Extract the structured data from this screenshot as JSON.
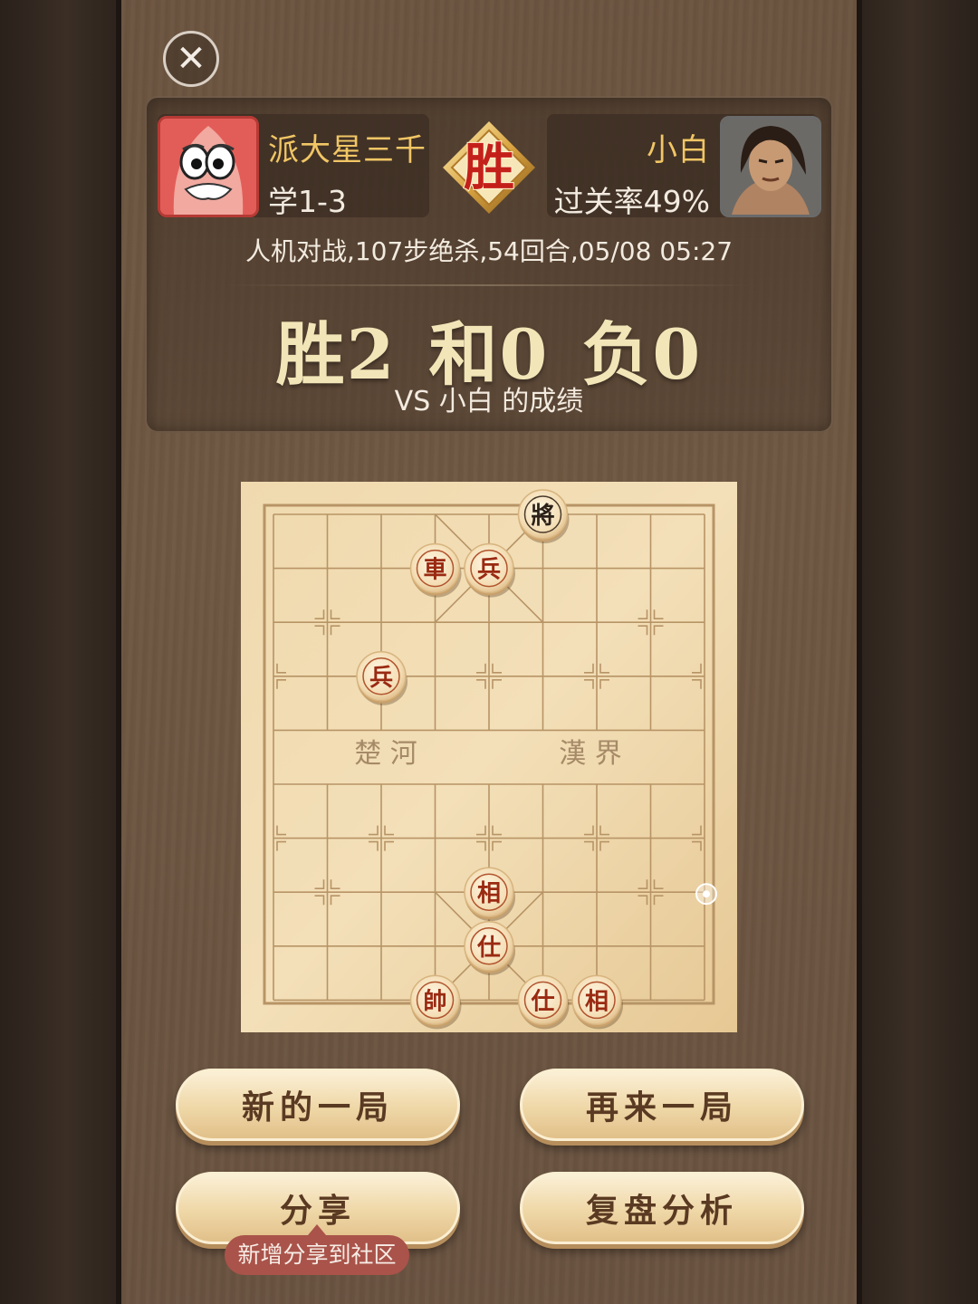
{
  "players": {
    "left": {
      "name": "派大星三千",
      "sub": "学1-3",
      "avatar": "patrick-star-avatar"
    },
    "right": {
      "name": "小白",
      "sub": "过关率49%",
      "avatar": "warrior-avatar"
    }
  },
  "result_badge": "胜",
  "game_info": "人机对战,107步绝杀,54回合,05/08 05:27",
  "score": {
    "win": "胜2",
    "draw": "和0",
    "loss": "负0"
  },
  "score_subtitle": "VS 小白 的成绩",
  "board": {
    "river_left": "楚 河",
    "river_right": "漢 界",
    "pieces": [
      {
        "label": "將",
        "col": 5,
        "row": 0,
        "side": "black"
      },
      {
        "label": "車",
        "col": 3,
        "row": 1,
        "side": "red"
      },
      {
        "label": "兵",
        "col": 4,
        "row": 1,
        "side": "red"
      },
      {
        "label": "兵",
        "col": 2,
        "row": 3,
        "side": "red"
      },
      {
        "label": "相",
        "col": 4,
        "row": 7,
        "side": "red"
      },
      {
        "label": "仕",
        "col": 4,
        "row": 8,
        "side": "red"
      },
      {
        "label": "帥",
        "col": 3,
        "row": 9,
        "side": "red"
      },
      {
        "label": "仕",
        "col": 5,
        "row": 9,
        "side": "red"
      },
      {
        "label": "相",
        "col": 6,
        "row": 9,
        "side": "red"
      }
    ],
    "last_move_marker": {
      "col": 8,
      "row": 7
    }
  },
  "buttons": {
    "new_game": "新的一局",
    "rematch": "再来一局",
    "share": "分享",
    "review": "复盘分析"
  },
  "share_tooltip": "新增分享到社区",
  "colors": {
    "accent_gold": "#f1c665",
    "red_piece_text": "#9a2a12",
    "tooltip_bg": "#a9534a"
  }
}
